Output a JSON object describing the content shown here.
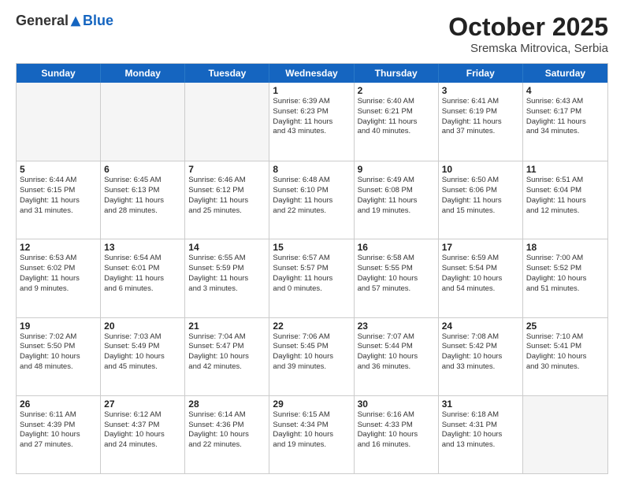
{
  "header": {
    "logo": {
      "general": "General",
      "blue": "Blue"
    },
    "title": "October 2025",
    "subtitle": "Sremska Mitrovica, Serbia"
  },
  "weekdays": [
    "Sunday",
    "Monday",
    "Tuesday",
    "Wednesday",
    "Thursday",
    "Friday",
    "Saturday"
  ],
  "weeks": [
    [
      {
        "day": "",
        "info": ""
      },
      {
        "day": "",
        "info": ""
      },
      {
        "day": "",
        "info": ""
      },
      {
        "day": "1",
        "info": "Sunrise: 6:39 AM\nSunset: 6:23 PM\nDaylight: 11 hours\nand 43 minutes."
      },
      {
        "day": "2",
        "info": "Sunrise: 6:40 AM\nSunset: 6:21 PM\nDaylight: 11 hours\nand 40 minutes."
      },
      {
        "day": "3",
        "info": "Sunrise: 6:41 AM\nSunset: 6:19 PM\nDaylight: 11 hours\nand 37 minutes."
      },
      {
        "day": "4",
        "info": "Sunrise: 6:43 AM\nSunset: 6:17 PM\nDaylight: 11 hours\nand 34 minutes."
      }
    ],
    [
      {
        "day": "5",
        "info": "Sunrise: 6:44 AM\nSunset: 6:15 PM\nDaylight: 11 hours\nand 31 minutes."
      },
      {
        "day": "6",
        "info": "Sunrise: 6:45 AM\nSunset: 6:13 PM\nDaylight: 11 hours\nand 28 minutes."
      },
      {
        "day": "7",
        "info": "Sunrise: 6:46 AM\nSunset: 6:12 PM\nDaylight: 11 hours\nand 25 minutes."
      },
      {
        "day": "8",
        "info": "Sunrise: 6:48 AM\nSunset: 6:10 PM\nDaylight: 11 hours\nand 22 minutes."
      },
      {
        "day": "9",
        "info": "Sunrise: 6:49 AM\nSunset: 6:08 PM\nDaylight: 11 hours\nand 19 minutes."
      },
      {
        "day": "10",
        "info": "Sunrise: 6:50 AM\nSunset: 6:06 PM\nDaylight: 11 hours\nand 15 minutes."
      },
      {
        "day": "11",
        "info": "Sunrise: 6:51 AM\nSunset: 6:04 PM\nDaylight: 11 hours\nand 12 minutes."
      }
    ],
    [
      {
        "day": "12",
        "info": "Sunrise: 6:53 AM\nSunset: 6:02 PM\nDaylight: 11 hours\nand 9 minutes."
      },
      {
        "day": "13",
        "info": "Sunrise: 6:54 AM\nSunset: 6:01 PM\nDaylight: 11 hours\nand 6 minutes."
      },
      {
        "day": "14",
        "info": "Sunrise: 6:55 AM\nSunset: 5:59 PM\nDaylight: 11 hours\nand 3 minutes."
      },
      {
        "day": "15",
        "info": "Sunrise: 6:57 AM\nSunset: 5:57 PM\nDaylight: 11 hours\nand 0 minutes."
      },
      {
        "day": "16",
        "info": "Sunrise: 6:58 AM\nSunset: 5:55 PM\nDaylight: 10 hours\nand 57 minutes."
      },
      {
        "day": "17",
        "info": "Sunrise: 6:59 AM\nSunset: 5:54 PM\nDaylight: 10 hours\nand 54 minutes."
      },
      {
        "day": "18",
        "info": "Sunrise: 7:00 AM\nSunset: 5:52 PM\nDaylight: 10 hours\nand 51 minutes."
      }
    ],
    [
      {
        "day": "19",
        "info": "Sunrise: 7:02 AM\nSunset: 5:50 PM\nDaylight: 10 hours\nand 48 minutes."
      },
      {
        "day": "20",
        "info": "Sunrise: 7:03 AM\nSunset: 5:49 PM\nDaylight: 10 hours\nand 45 minutes."
      },
      {
        "day": "21",
        "info": "Sunrise: 7:04 AM\nSunset: 5:47 PM\nDaylight: 10 hours\nand 42 minutes."
      },
      {
        "day": "22",
        "info": "Sunrise: 7:06 AM\nSunset: 5:45 PM\nDaylight: 10 hours\nand 39 minutes."
      },
      {
        "day": "23",
        "info": "Sunrise: 7:07 AM\nSunset: 5:44 PM\nDaylight: 10 hours\nand 36 minutes."
      },
      {
        "day": "24",
        "info": "Sunrise: 7:08 AM\nSunset: 5:42 PM\nDaylight: 10 hours\nand 33 minutes."
      },
      {
        "day": "25",
        "info": "Sunrise: 7:10 AM\nSunset: 5:41 PM\nDaylight: 10 hours\nand 30 minutes."
      }
    ],
    [
      {
        "day": "26",
        "info": "Sunrise: 6:11 AM\nSunset: 4:39 PM\nDaylight: 10 hours\nand 27 minutes."
      },
      {
        "day": "27",
        "info": "Sunrise: 6:12 AM\nSunset: 4:37 PM\nDaylight: 10 hours\nand 24 minutes."
      },
      {
        "day": "28",
        "info": "Sunrise: 6:14 AM\nSunset: 4:36 PM\nDaylight: 10 hours\nand 22 minutes."
      },
      {
        "day": "29",
        "info": "Sunrise: 6:15 AM\nSunset: 4:34 PM\nDaylight: 10 hours\nand 19 minutes."
      },
      {
        "day": "30",
        "info": "Sunrise: 6:16 AM\nSunset: 4:33 PM\nDaylight: 10 hours\nand 16 minutes."
      },
      {
        "day": "31",
        "info": "Sunrise: 6:18 AM\nSunset: 4:31 PM\nDaylight: 10 hours\nand 13 minutes."
      },
      {
        "day": "",
        "info": ""
      }
    ]
  ]
}
